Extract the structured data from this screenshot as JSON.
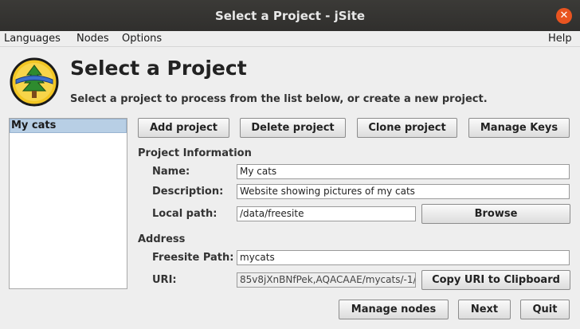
{
  "window": {
    "title": "Select a Project - jSite"
  },
  "menu": {
    "items": [
      "Languages",
      "Nodes",
      "Options"
    ],
    "help": "Help"
  },
  "header": {
    "title": "Select a Project",
    "subtitle": "Select a project to process from the list below, or create a new project."
  },
  "projects": {
    "items": [
      "My cats"
    ],
    "selected": "My cats"
  },
  "toolbar": {
    "add_project": "Add project",
    "delete_project": "Delete project",
    "clone_project": "Clone project",
    "manage_keys": "Manage Keys"
  },
  "project_info": {
    "section_label": "Project Information",
    "name_label": "Name:",
    "name_value": "My cats",
    "description_label": "Description:",
    "description_value": "Website showing pictures of my cats",
    "local_path_label": "Local path:",
    "local_path_value": "/data/freesite",
    "browse_label": "Browse"
  },
  "address": {
    "section_label": "Address",
    "freesite_path_label": "Freesite Path:",
    "freesite_path_value": "mycats",
    "uri_label": "URI:",
    "uri_value": "85v8jXnBNfPek,AQACAAE/mycats/-1/",
    "copy_uri_label": "Copy URI to Clipboard"
  },
  "footer": {
    "manage_nodes": "Manage nodes",
    "next": "Next",
    "quit": "Quit"
  },
  "colors": {
    "close_button": "#e95420",
    "selection": "#b8cfe5",
    "titlebar": "#302f2d"
  }
}
